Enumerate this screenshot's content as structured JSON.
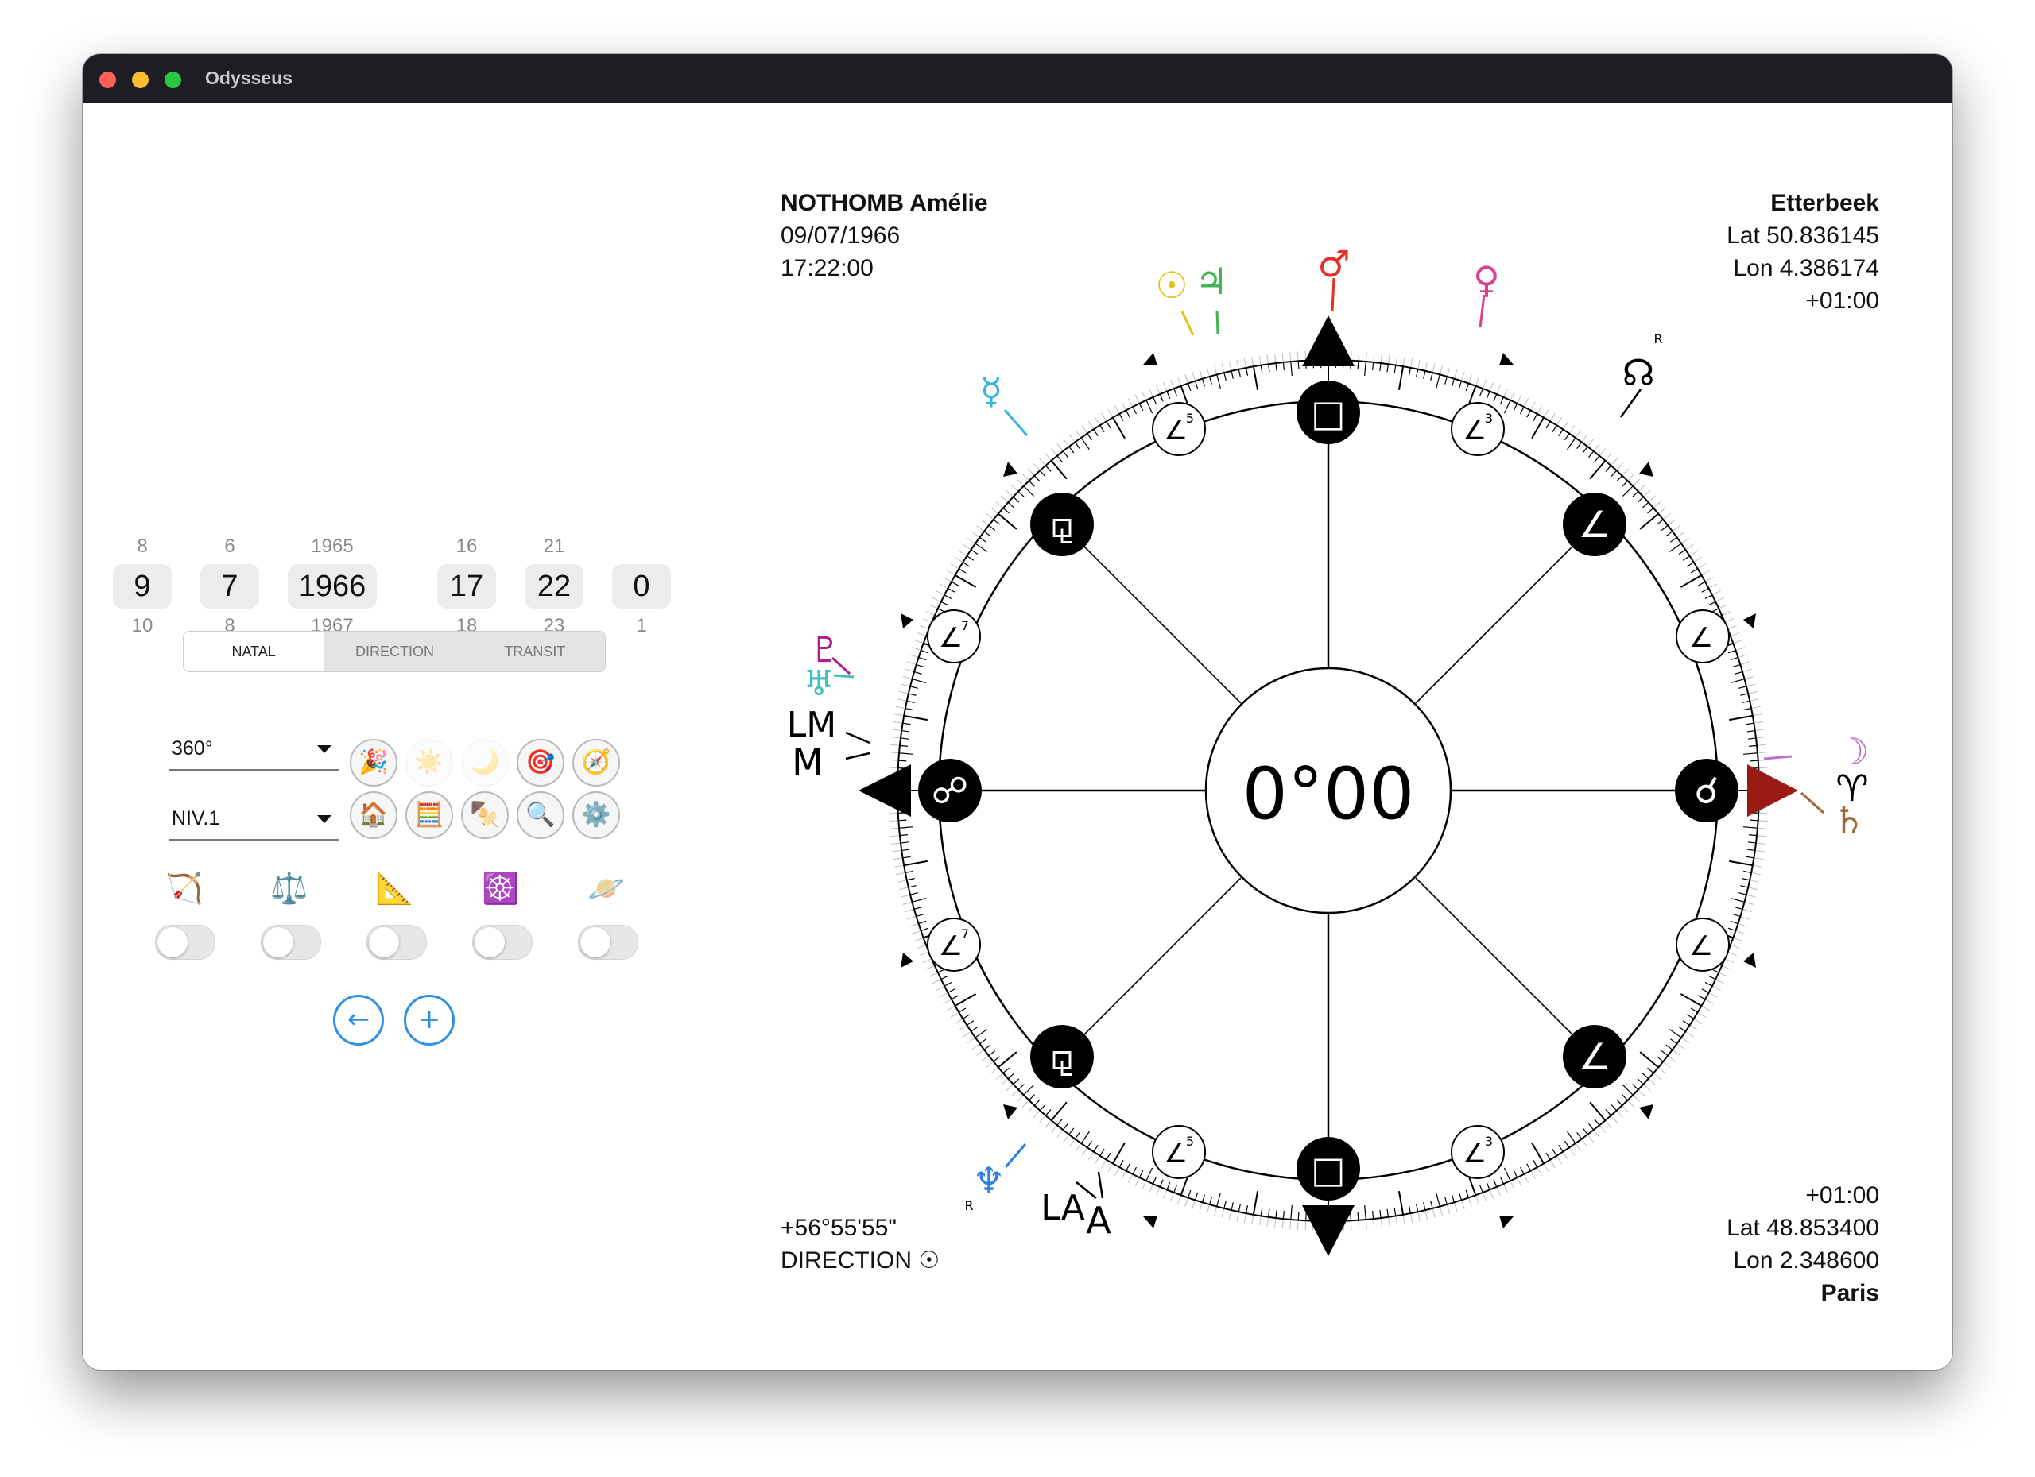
{
  "window": {
    "title": "Odysseus"
  },
  "pickers": [
    {
      "name": "day",
      "prev": "8",
      "value": "9",
      "next": "10"
    },
    {
      "name": "month",
      "prev": "6",
      "value": "7",
      "next": "8"
    },
    {
      "name": "year",
      "prev": "1965",
      "value": "1966",
      "next": "1967"
    },
    {
      "name": "hour",
      "prev": "16",
      "value": "17",
      "next": "18"
    },
    {
      "name": "minute",
      "prev": "21",
      "value": "22",
      "next": "23"
    },
    {
      "name": "second",
      "prev": "",
      "value": "0",
      "next": "1"
    }
  ],
  "modes": {
    "natal": "NATAL",
    "direction": "DIRECTION",
    "transit": "TRANSIT"
  },
  "selects": {
    "degrees": "360°",
    "level": "NIV.1"
  },
  "tools_row1": [
    "🎉",
    "☀️",
    "🌙",
    "🎯",
    "🧭"
  ],
  "tools_row2": [
    "🏠",
    "🧮",
    "🍢",
    "🔍",
    "⚙️"
  ],
  "toggles": [
    "🏹",
    "⚖️",
    "📐",
    "☸️",
    "🪐"
  ],
  "actions": {
    "back": "←",
    "add": "+"
  },
  "chart_left_top": {
    "name": "NOTHOMB Amélie",
    "date": "09/07/1966",
    "time": "17:22:00"
  },
  "chart_right_top": {
    "place": "Etterbeek",
    "lat": "Lat 50.836145",
    "lon": "Lon 4.386174",
    "tz": "+01:00"
  },
  "chart_left_bottom": {
    "arc": "+56°55'55\"",
    "mode": "DIRECTION ☉"
  },
  "chart_right_bottom": {
    "tz": "+01:00",
    "lat": "Lat 48.853400",
    "lon": "Lon 2.348600",
    "place": "Paris"
  },
  "chart": {
    "center": "0°00",
    "aspects": [
      "□",
      "∠",
      "⚹",
      "∠",
      "☌",
      "⚹",
      "∠",
      "⚼",
      "□",
      "⚼",
      "☍",
      "⚹"
    ],
    "planets": {
      "sun": "☉",
      "jupiter": "♃",
      "mars": "♂",
      "venus": "♀",
      "node": "☊",
      "node_r": "R",
      "mercury": "☿",
      "pluto": "♇",
      "uranus": "♅",
      "moon": "☽",
      "aries": "♈",
      "saturn": "♄",
      "neptune": "♆",
      "neptune_r": "R"
    },
    "angles": {
      "mc": "M",
      "mc_l": "LM",
      "asc": "A",
      "asc_l": "LA"
    },
    "minor_labels": [
      "5",
      "3",
      "7",
      "7",
      "5",
      "3"
    ]
  },
  "colors": {
    "accent": "#2f8fe0",
    "sun": "#e3c21b",
    "jupiter": "#3fb34f",
    "mars": "#e5302a",
    "venus": "#e0408a",
    "mercury": "#35b4e0",
    "pluto": "#b0208a",
    "uranus": "#40c0c0",
    "moon": "#c070d0",
    "saturn": "#a0683a",
    "neptune": "#2f7fe0",
    "pointer": "#9a1b14"
  }
}
